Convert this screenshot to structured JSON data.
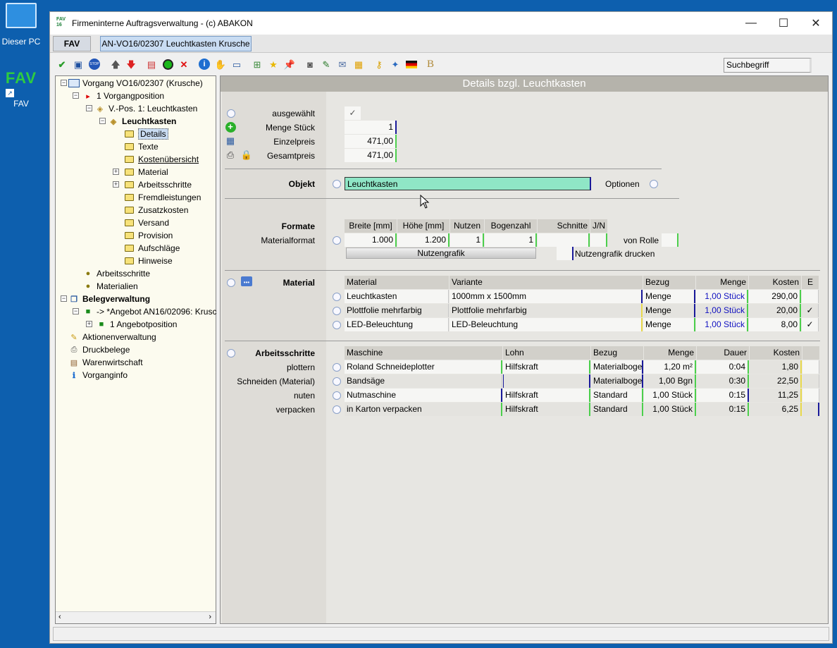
{
  "desktop": {
    "icons": [
      {
        "label": "Dieser PC",
        "icon": "computer-icon"
      },
      {
        "label": "FAV",
        "icon": "fav-shortcut-icon"
      }
    ]
  },
  "window": {
    "title": "Firmeninterne Auftragsverwaltung - (c) ABAKON",
    "logo_text": "FAV 16",
    "controls": [
      "minimize",
      "maximize",
      "close"
    ]
  },
  "tabs": [
    {
      "label": "FAV",
      "active": false
    },
    {
      "label": "AN-VO16/02307 Leuchtkasten Krusche",
      "active": true
    }
  ],
  "toolbar": {
    "search_value": "Suchbegriff",
    "buttons": [
      "check-icon",
      "save-icon",
      "stop-icon",
      "arrow-up-icon",
      "arrow-down-icon",
      "new-doc-icon",
      "go-icon",
      "delete-icon",
      "info-icon",
      "hand-icon",
      "monitor-icon",
      "tree-icon",
      "star-icon",
      "pin-icon",
      "camera-icon",
      "edit-icon",
      "mail-icon",
      "note-icon",
      "key-icon",
      "wand-icon",
      "flag-de-icon",
      "bold-b-icon"
    ]
  },
  "tree": {
    "nodes": [
      {
        "label": "Vorgang VO16/02307 (Krusche)",
        "icon": "window-icon"
      },
      {
        "label": "1 Vorgangposition",
        "icon": "red-flag-icon"
      },
      {
        "label": "V.-Pos. 1: Leuchtkasten",
        "icon": "tag-icon"
      },
      {
        "label": "Leuchtkasten",
        "icon": "tag-icon"
      },
      {
        "label": "Details",
        "icon": "folder-icon"
      },
      {
        "label": "Texte",
        "icon": "folder-icon"
      },
      {
        "label": "Kostenübersicht",
        "icon": "folder-icon"
      },
      {
        "label": "Material",
        "icon": "folder-icon"
      },
      {
        "label": "Arbeitsschritte",
        "icon": "folder-icon"
      },
      {
        "label": "Fremdleistungen",
        "icon": "folder-icon"
      },
      {
        "label": "Zusatzkosten",
        "icon": "folder-icon"
      },
      {
        "label": "Versand",
        "icon": "folder-icon"
      },
      {
        "label": "Provision",
        "icon": "folder-icon"
      },
      {
        "label": "Aufschläge",
        "icon": "folder-icon"
      },
      {
        "label": "Hinweise",
        "icon": "folder-icon"
      },
      {
        "label": "Arbeitsschritte",
        "icon": "bullet-icon"
      },
      {
        "label": "Materialien",
        "icon": "bullet-icon"
      },
      {
        "label": "Belegverwaltung",
        "icon": "documents-icon"
      },
      {
        "label": "-> *Angebot AN16/02096: Krusc",
        "icon": "green-bullet-icon"
      },
      {
        "label": "1 Angebotposition",
        "icon": "green-bullet-icon"
      },
      {
        "label": "Aktionenverwaltung",
        "icon": "actions-icon"
      },
      {
        "label": "Druckbelege",
        "icon": "printer-icon"
      },
      {
        "label": "Warenwirtschaft",
        "icon": "goods-icon"
      },
      {
        "label": "Vorganginfo",
        "icon": "info-icon"
      }
    ]
  },
  "details": {
    "header": "Details bzgl. Leuchtkasten",
    "ausgewaehlt_label": "ausgewählt",
    "ausgewaehlt_value": "✓",
    "menge_label": "Menge Stück",
    "menge_value": "1",
    "einzelpreis_label": "Einzelpreis",
    "einzelpreis_value": "471,00",
    "gesamtpreis_label": "Gesamtpreis",
    "gesamtpreis_value": "471,00",
    "objekt_label": "Objekt",
    "objekt_value": "Leuchtkasten",
    "optionen_label": "Optionen",
    "formate_label": "Formate",
    "materialformat_label": "Materialformat",
    "formate_headers": [
      "Breite [mm]",
      "Höhe [mm]",
      "Nutzen",
      "Bogenzahl",
      "Schnitte",
      "J/N"
    ],
    "formate_values": [
      "1.000",
      "1.200",
      "1",
      "1",
      "",
      ""
    ],
    "von_rolle_label": "von Rolle",
    "nutzengrafik_button": "Nutzengrafik",
    "nutzengrafik_drucken_label": "Nutzengrafik drucken"
  },
  "material": {
    "label": "Material",
    "headers": [
      "Material",
      "Variante",
      "Bezug",
      "Menge",
      "Kosten",
      "E"
    ],
    "rows": [
      {
        "material": "Leuchtkasten",
        "variante": "1000mm x 1500mm",
        "bezug": "Menge",
        "menge": "1,00 Stück",
        "kosten": "290,00",
        "e": ""
      },
      {
        "material": "Plottfolie mehrfarbig",
        "variante": "Plottfolie mehrfarbig",
        "bezug": "Menge",
        "menge": "1,00 Stück",
        "kosten": "20,00",
        "e": "✓"
      },
      {
        "material": "LED-Beleuchtung",
        "variante": "LED-Beleuchtung",
        "bezug": "Menge",
        "menge": "1,00 Stück",
        "kosten": "8,00",
        "e": "✓"
      }
    ]
  },
  "arbeitsschritte": {
    "label": "Arbeitsschritte",
    "headers": [
      "Maschine",
      "Lohn",
      "Bezug",
      "Menge",
      "Dauer",
      "Kosten"
    ],
    "rows": [
      {
        "name": "plottern",
        "maschine": "Roland Schneideplotter",
        "lohn": "Hilfskraft",
        "bezug": "Materialbogen",
        "menge": "1,20 m²",
        "dauer": "0:04",
        "kosten": "1,80"
      },
      {
        "name": "Schneiden (Material)",
        "maschine": "Bandsäge",
        "lohn": "",
        "bezug": "Materialbogen",
        "menge": "1,00 Bgn",
        "dauer": "0:30",
        "kosten": "22,50"
      },
      {
        "name": "nuten",
        "maschine": "Nutmaschine",
        "lohn": "Hilfskraft",
        "bezug": "Standard",
        "menge": "1,00 Stück",
        "dauer": "0:15",
        "kosten": "11,25"
      },
      {
        "name": "verpacken",
        "maschine": "in Karton verpacken",
        "lohn": "Hilfskraft",
        "bezug": "Standard",
        "menge": "1,00 Stück",
        "dauer": "0:15",
        "kosten": "6,25"
      }
    ]
  }
}
